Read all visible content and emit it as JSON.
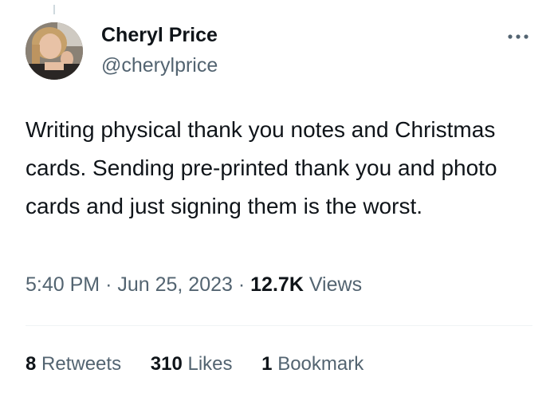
{
  "tweet": {
    "author": {
      "display_name": "Cheryl Price",
      "handle": "@cherylprice"
    },
    "more_icon": "more-horizontal-icon",
    "text": "Writing physical thank you notes and Christmas cards. Sending pre-printed thank you and photo cards and just signing them is the worst.",
    "meta": {
      "time": "5:40 PM",
      "separator": "·",
      "date": "Jun 25, 2023",
      "views_count": "12.7K",
      "views_label": "Views"
    },
    "stats": {
      "retweets_count": "8",
      "retweets_label": "Retweets",
      "likes_count": "310",
      "likes_label": "Likes",
      "bookmarks_count": "1",
      "bookmarks_label": "Bookmark"
    }
  },
  "colors": {
    "primary_text": "#0f1419",
    "secondary_text": "#536471",
    "divider": "#eff3f4"
  }
}
